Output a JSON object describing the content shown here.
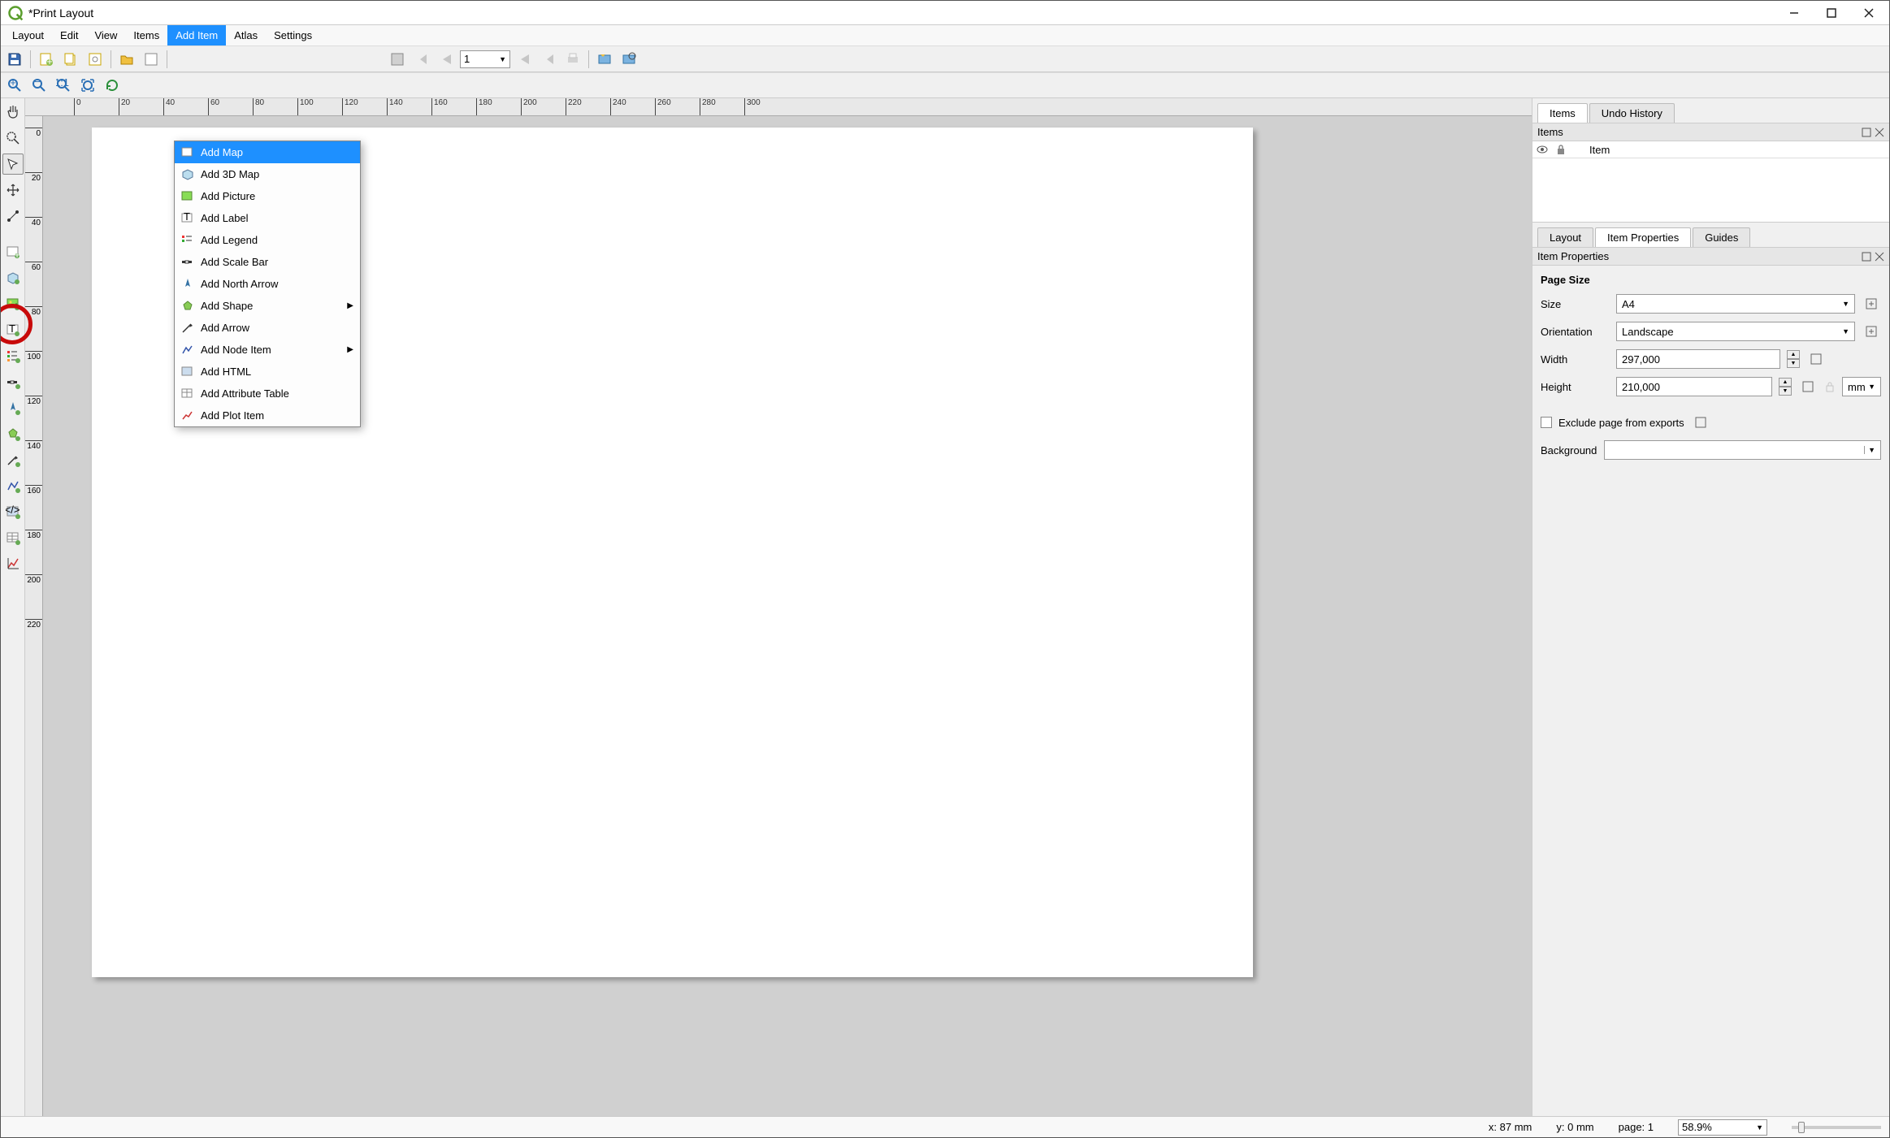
{
  "window": {
    "title": "*Print Layout"
  },
  "menubar": {
    "layout": "Layout",
    "edit": "Edit",
    "view": "View",
    "items": "Items",
    "add_item": "Add Item",
    "atlas": "Atlas",
    "settings": "Settings"
  },
  "dropdown": {
    "add_map": "Add Map",
    "add_3d_map": "Add 3D Map",
    "add_picture": "Add Picture",
    "add_label": "Add Label",
    "add_legend": "Add Legend",
    "add_scale_bar": "Add Scale Bar",
    "add_north_arrow": "Add North Arrow",
    "add_shape": "Add Shape",
    "add_arrow": "Add Arrow",
    "add_node_item": "Add Node Item",
    "add_html": "Add HTML",
    "add_attribute_table": "Add Attribute Table",
    "add_plot_item": "Add Plot Item"
  },
  "toolbar": {
    "page_value": "1"
  },
  "ruler_h": [
    "0",
    "20",
    "40",
    "60",
    "80",
    "100",
    "120",
    "140",
    "160",
    "180",
    "200",
    "220",
    "240",
    "260",
    "280",
    "300"
  ],
  "ruler_v": [
    "0",
    "20",
    "40",
    "60",
    "80",
    "100",
    "120",
    "140",
    "160",
    "180",
    "200",
    "220"
  ],
  "right": {
    "tabs": {
      "items": "Items",
      "undo": "Undo History"
    },
    "items_panel_title": "Items",
    "item_col": "Item",
    "prop_tabs": {
      "layout": "Layout",
      "item_props": "Item Properties",
      "guides": "Guides"
    },
    "item_props_title": "Item Properties",
    "page_size_section": "Page Size",
    "size_label": "Size",
    "size_value": "A4",
    "orientation_label": "Orientation",
    "orientation_value": "Landscape",
    "width_label": "Width",
    "width_value": "297,000",
    "height_label": "Height",
    "height_value": "210,000",
    "unit": "mm",
    "exclude_label": "Exclude page from exports",
    "background_label": "Background"
  },
  "status": {
    "x": "x: 87 mm",
    "y": "y: 0 mm",
    "page": "page: 1",
    "zoom": "58.9%"
  }
}
